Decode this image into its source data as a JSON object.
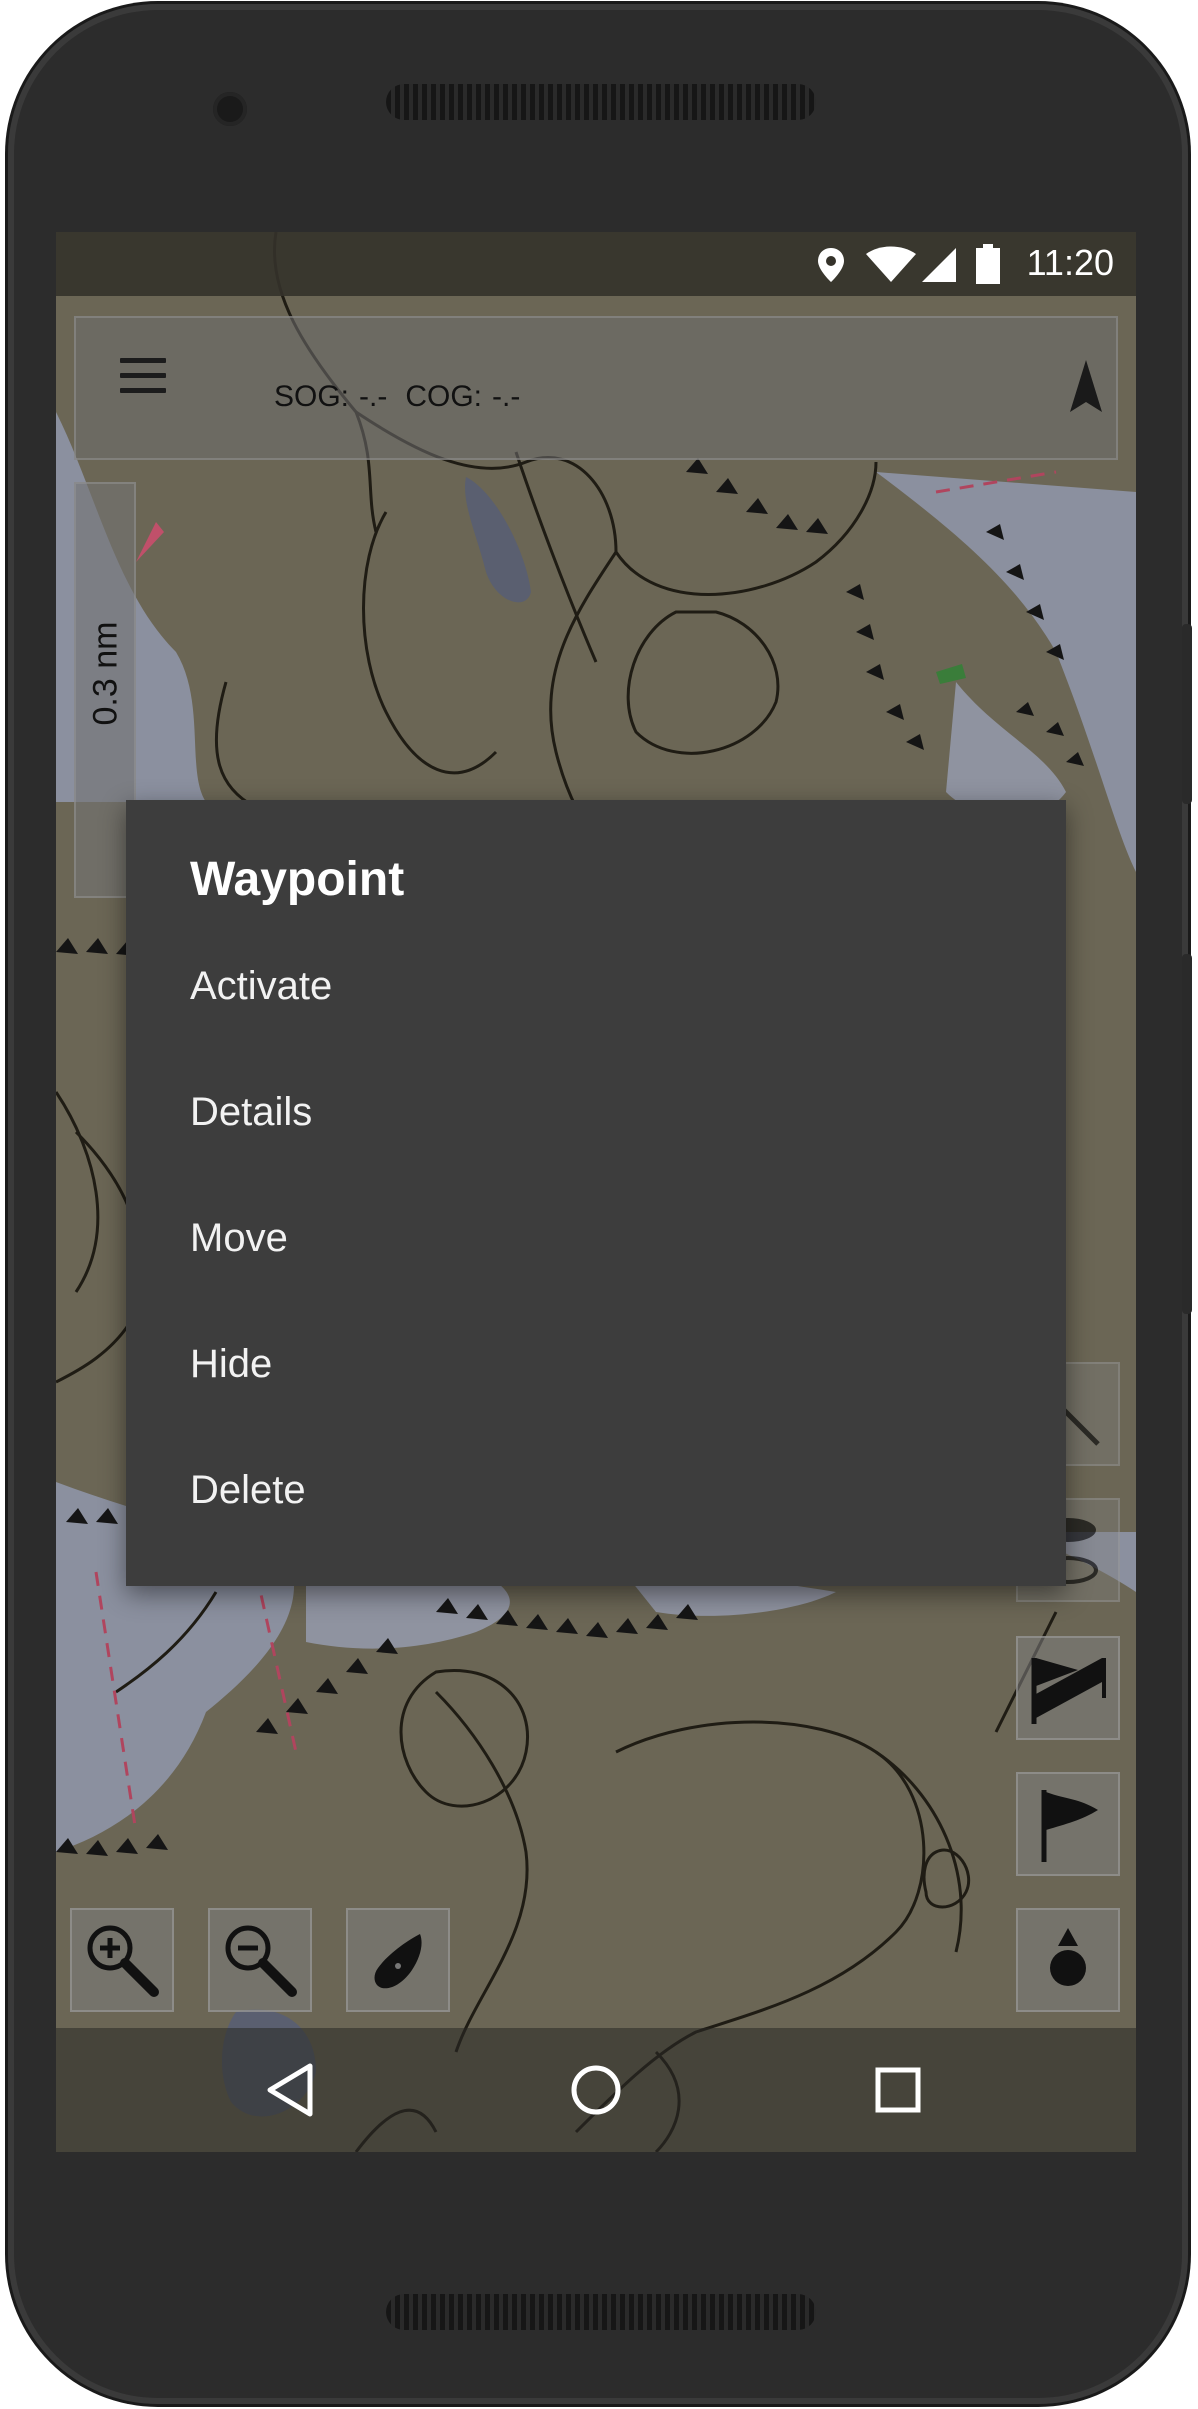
{
  "status_bar": {
    "time": "11:20",
    "icons": [
      "location-icon",
      "wifi-icon",
      "signal-icon",
      "battery-icon"
    ]
  },
  "toolbar": {
    "menu_icon": "menu-icon",
    "sog_label": "SOG:",
    "sog_value": "-.-",
    "cog_label": "COG:",
    "cog_value": "-.-",
    "north_icon": "north-arrow-icon"
  },
  "scale": {
    "label": "0.3 nm"
  },
  "dialog": {
    "title": "Waypoint",
    "items": [
      {
        "label": "Activate"
      },
      {
        "label": "Details"
      },
      {
        "label": "Move"
      },
      {
        "label": "Hide"
      },
      {
        "label": "Delete"
      }
    ]
  },
  "map_controls": {
    "left": [
      "zoom-in-icon",
      "zoom-out-icon",
      "boat-icon"
    ],
    "right": [
      "route-flags-icon",
      "flag-icon",
      "waypoint-marker-icon"
    ]
  },
  "nav_bar": {
    "icons": [
      "back-icon",
      "home-icon",
      "recents-icon"
    ]
  },
  "colors": {
    "dialog_bg": "#3d3d3d",
    "dialog_text": "#ffffff",
    "map_land": "#6b6655",
    "map_water": "#8b909f",
    "phone_body": "#2c2c2c"
  }
}
